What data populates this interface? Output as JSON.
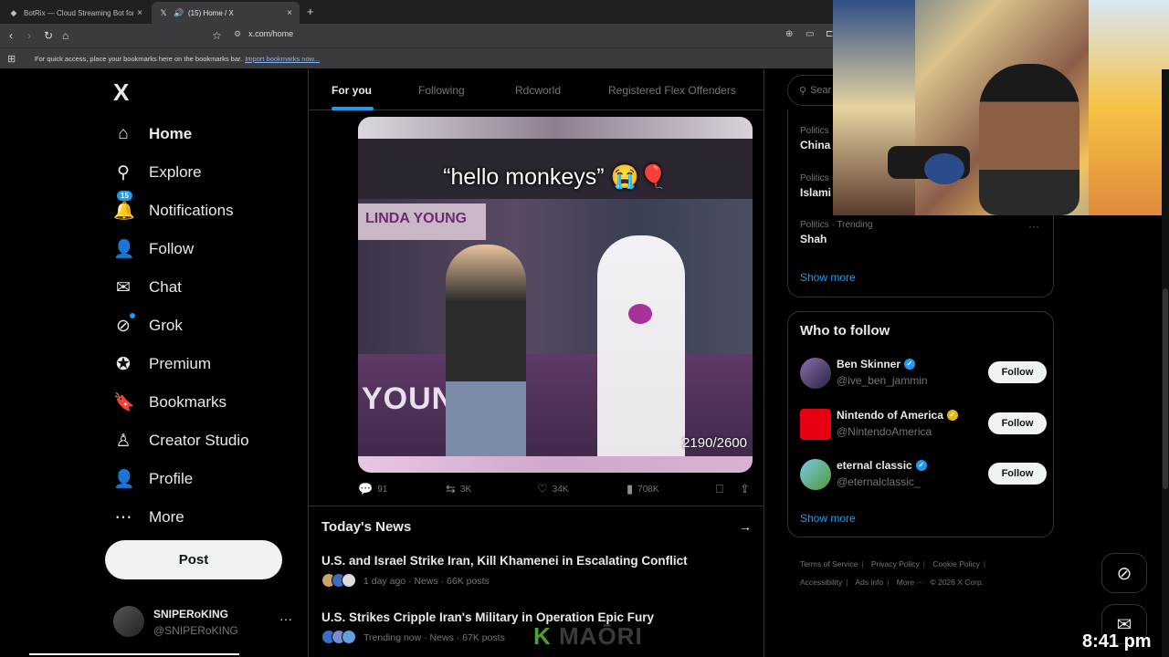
{
  "browser": {
    "tabs": [
      {
        "title": "BotRix — Cloud Streaming Bot for Tw",
        "icon": "botrix-icon",
        "active": false
      },
      {
        "title": "(15) Home / X",
        "icon": "x-logo-icon",
        "active": true
      }
    ],
    "url": "x.com/home",
    "bookmarks_message": "For quick access, place your bookmarks here on the bookmarks bar.",
    "bookmarks_link": "Import bookmarks now..."
  },
  "sidebar": {
    "logo": "X",
    "items": [
      {
        "label": "Home",
        "icon": "home-icon",
        "glyph": "⌂"
      },
      {
        "label": "Explore",
        "icon": "search-icon",
        "glyph": "⚲"
      },
      {
        "label": "Notifications",
        "icon": "bell-icon",
        "glyph": "🔔",
        "badge": "15"
      },
      {
        "label": "Follow",
        "icon": "add-person-icon",
        "glyph": "👤"
      },
      {
        "label": "Chat",
        "icon": "envelope-icon",
        "glyph": "✉"
      },
      {
        "label": "Grok",
        "icon": "grok-icon",
        "glyph": "⊘"
      },
      {
        "label": "Premium",
        "icon": "verified-icon",
        "glyph": "✪"
      },
      {
        "label": "Bookmarks",
        "icon": "bookmark-icon",
        "glyph": "🔖"
      },
      {
        "label": "Creator Studio",
        "icon": "creator-studio-icon",
        "glyph": "♙"
      },
      {
        "label": "Profile",
        "icon": "person-icon",
        "glyph": "👤"
      },
      {
        "label": "More",
        "icon": "more-circle-icon",
        "glyph": "⋯"
      }
    ],
    "post_label": "Post",
    "account": {
      "name": "SNIPERoKING",
      "handle": "@SNIPERoKING"
    }
  },
  "feed": {
    "tabs": [
      "For you",
      "Following",
      "Rdcworld",
      "Registered Flex Offenders"
    ],
    "video": {
      "caption": "“hello monkeys” 😭🎈",
      "banner": "LINDA YOUNG",
      "backdrop": "YOUNG",
      "counter": "2190/2600"
    },
    "actions": {
      "replies": "91",
      "reposts": "3K",
      "likes": "34K",
      "views": "708K"
    }
  },
  "news": {
    "title": "Today's News",
    "stories": [
      {
        "headline": "U.S. and Israel Strike Iran, Kill Khamenei in Escalating Conflict",
        "meta": "1 day ago · News · 66K posts"
      },
      {
        "headline": "U.S. Strikes Cripple Iran's Military in Operation Epic Fury",
        "meta": "Trending now · News · 67K posts"
      }
    ]
  },
  "right": {
    "search_placeholder": "Sear",
    "trends": [
      {
        "category": "Politics",
        "name": "China"
      },
      {
        "category": "Politics",
        "name": "Islami"
      },
      {
        "category": "Politics · Trending",
        "name": "Shah"
      }
    ],
    "trends_show_more": "Show more",
    "who_to_follow": {
      "title": "Who to follow",
      "accounts": [
        {
          "name": "Ben Skinner",
          "handle": "@ive_ben_jammin",
          "badge": "blue"
        },
        {
          "name": "Nintendo of America",
          "handle": "@NintendoAmerica",
          "badge": "gold"
        },
        {
          "name": "eternal classic",
          "handle": "@eternalclassic_",
          "badge": "blue"
        }
      ],
      "follow_label": "Follow",
      "show_more": "Show more"
    },
    "footer": {
      "links": [
        "Terms of Service",
        "Privacy Policy",
        "Cookie Policy",
        "Accessibility",
        "Ads info",
        "More ···"
      ],
      "copyright": "© 2026 X Corp."
    }
  },
  "overlay": {
    "clock": "8:41 pm",
    "watermark_k": "K",
    "watermark_rest": "MAŌRI"
  }
}
